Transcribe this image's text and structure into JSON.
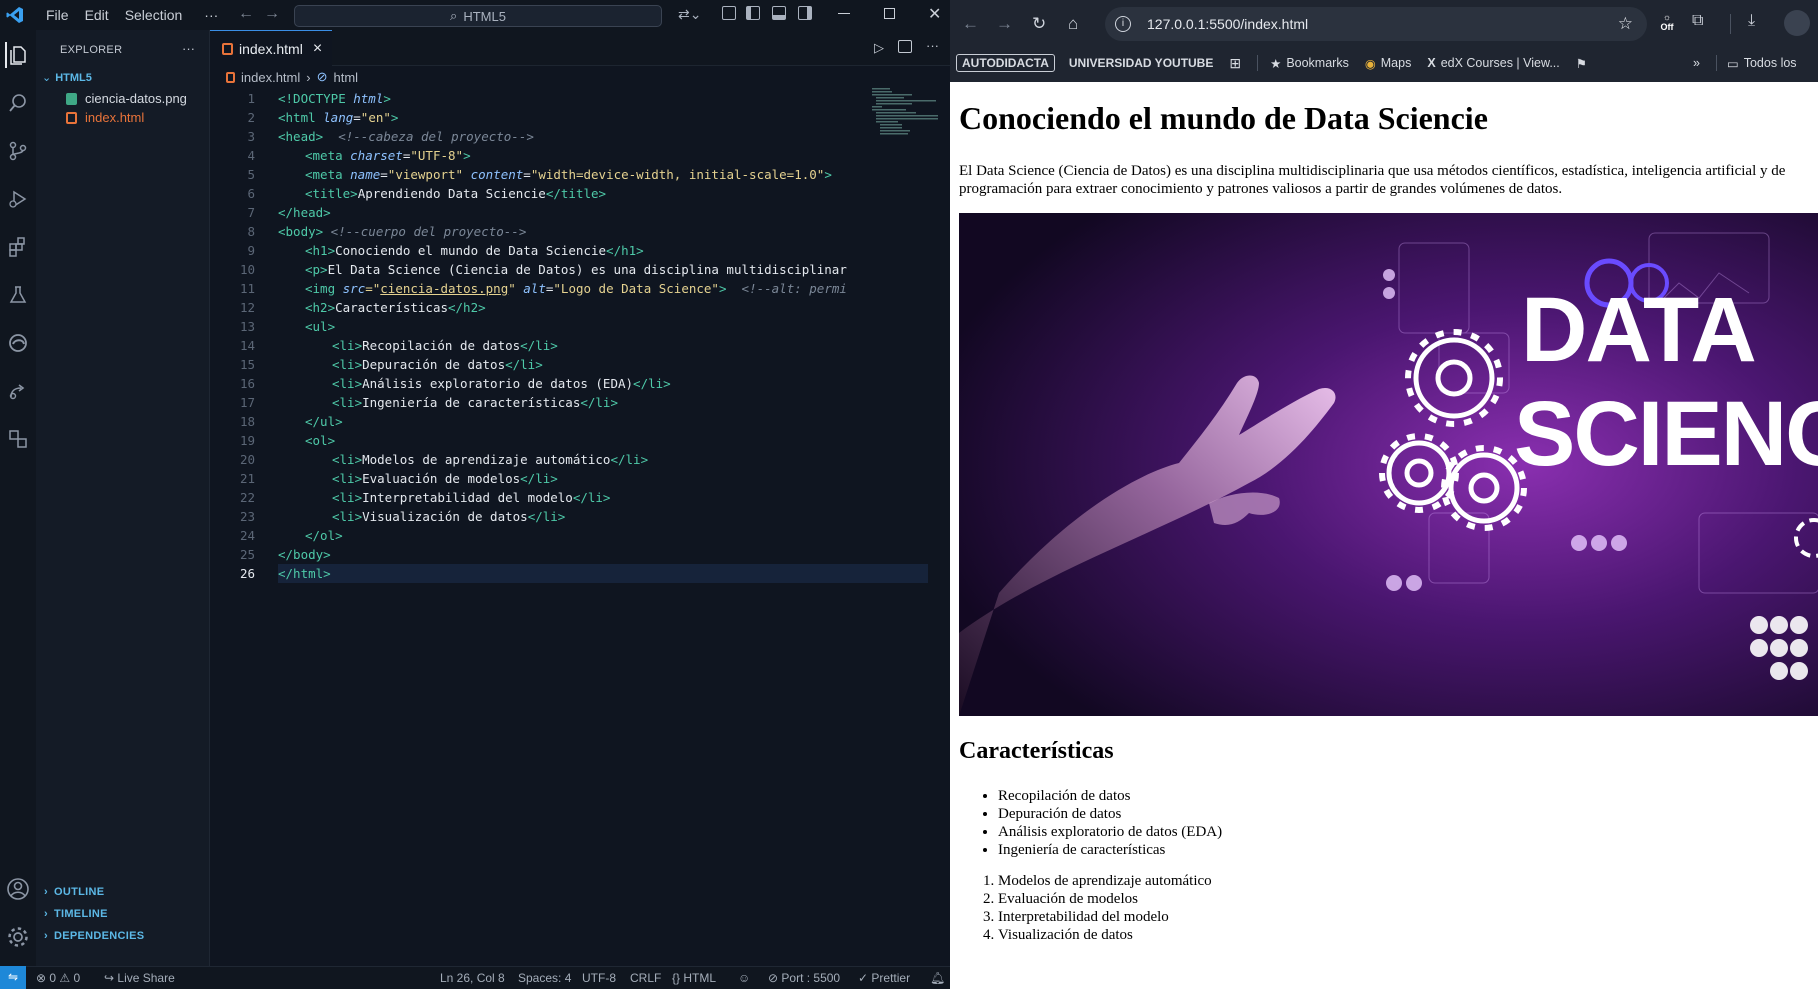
{
  "vscode": {
    "menu": [
      "File",
      "Edit",
      "Selection",
      "···"
    ],
    "command_center": "HTML5",
    "explorer_title": "EXPLORER",
    "explorer_more": "···",
    "folder": "HTML5",
    "files": [
      {
        "name": "ciencia-datos.png",
        "icon": "image-file-icon"
      },
      {
        "name": "index.html",
        "icon": "html-file-icon"
      }
    ],
    "bottom_sections": [
      "OUTLINE",
      "TIMELINE",
      "DEPENDENCIES"
    ],
    "tab": {
      "label": "index.html",
      "close": "×"
    },
    "breadcrumb": [
      "index.html",
      "html"
    ],
    "line_numbers": [
      "1",
      "2",
      "3",
      "4",
      "5",
      "6",
      "7",
      "8",
      "9",
      "10",
      "11",
      "12",
      "13",
      "14",
      "15",
      "16",
      "17",
      "18",
      "19",
      "20",
      "21",
      "22",
      "23",
      "24",
      "25",
      "26"
    ],
    "code": {
      "l1": {
        "a": "<!DOCTYPE",
        "b": " html",
        "c": ">"
      },
      "l2": {
        "a": "<html ",
        "b": "lang",
        "c": "=",
        "d": "\"en\"",
        "e": ">"
      },
      "l3": {
        "a": "<head>",
        "b": "  <!--cabeza del proyecto-->"
      },
      "l4": {
        "a": "<meta ",
        "b": "charset",
        "c": "=",
        "d": "\"UTF-8\"",
        "e": ">"
      },
      "l5": {
        "a": "<meta ",
        "b": "name",
        "c": "=",
        "d": "\"viewport\"",
        "e": " content",
        "f": "=",
        "g": "\"width=device-width, initial-scale=1.0\"",
        "h": ">"
      },
      "l6": {
        "a": "<title>",
        "b": "Aprendiendo Data Sciencie",
        "c": "</title>"
      },
      "l7": {
        "a": "</head>"
      },
      "l8": {
        "a": "<body>",
        "b": " <!--cuerpo del proyecto-->"
      },
      "l9": {
        "a": "<h1>",
        "b": "Conociendo el mundo de Data Sciencie",
        "c": "</h1>"
      },
      "l10": {
        "a": "<p>",
        "b": "El Data Science (Ciencia de Datos) es una disciplina multidisciplinar"
      },
      "l11": {
        "a": "<img ",
        "b": "src",
        "c": "=\"",
        "d": "ciencia-datos.png",
        "e": "\"",
        "f": " alt",
        "g": "=",
        "h": "\"Logo de Data Science\"",
        "i": ">",
        "j": "  <!--alt: permi"
      },
      "l12": {
        "a": "<h2>",
        "b": "Características",
        "c": "</h2>"
      },
      "l13": {
        "a": "<ul>"
      },
      "l14": {
        "a": "<li>",
        "b": "Recopilación de datos",
        "c": "</li>"
      },
      "l15": {
        "a": "<li>",
        "b": "Depuración de datos",
        "c": "</li>"
      },
      "l16": {
        "a": "<li>",
        "b": "Análisis exploratorio de datos (EDA)",
        "c": "</li>"
      },
      "l17": {
        "a": "<li>",
        "b": "Ingeniería de características",
        "c": "</li>"
      },
      "l18": {
        "a": "</ul>"
      },
      "l19": {
        "a": "<ol>"
      },
      "l20": {
        "a": "<li>",
        "b": "Modelos de aprendizaje automático",
        "c": "</li>"
      },
      "l21": {
        "a": "<li>",
        "b": "Evaluación de modelos",
        "c": "</li>"
      },
      "l22": {
        "a": "<li>",
        "b": "Interpretabilidad del modelo",
        "c": "</li>"
      },
      "l23": {
        "a": "<li>",
        "b": "Visualización de datos",
        "c": "</li>"
      },
      "l24": {
        "a": "</ol>"
      },
      "l25": {
        "a": "</body>"
      },
      "l26": {
        "a": "</html>"
      }
    },
    "status": {
      "problems": "⊗ 0 ⚠ 0",
      "live_share": "Live Share",
      "position": "Ln 26, Col 8",
      "spaces": "Spaces: 4",
      "encoding": "UTF-8",
      "eol": "CRLF",
      "language": "{} HTML",
      "port": "Port : 5500",
      "prettier": "Prettier"
    }
  },
  "browser": {
    "url": "127.0.0.1:5500/index.html",
    "bookmarks": {
      "b1": "AUTODIDACTA",
      "b2": "UNIVERSIDAD YOUTUBE",
      "b3": "Bookmarks",
      "b4": "Maps",
      "b5": "edX Courses | View...",
      "b6": "Todos los"
    },
    "page": {
      "h1": "Conociendo el mundo de Data Sciencie",
      "paragraph": "El Data Science (Ciencia de Datos) es una disciplina multidisciplinaria que usa métodos científicos, estadística, inteligencia artificial y de programación para extraer conocimiento y patrones valiosos a partir de grandes volúmenes de datos.",
      "hero_text_1": "DATA",
      "hero_text_2": "SCIENC",
      "h2": "Características",
      "ul": [
        "Recopilación de datos",
        "Depuración de datos",
        "Análisis exploratorio de datos (EDA)",
        "Ingeniería de características"
      ],
      "ol": [
        "Modelos de aprendizaje automático",
        "Evaluación de modelos",
        "Interpretabilidad del modelo",
        "Visualización de datos"
      ]
    }
  }
}
